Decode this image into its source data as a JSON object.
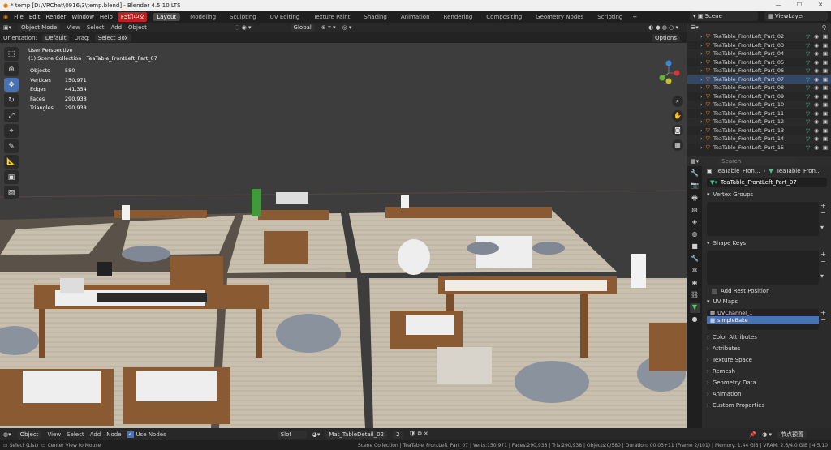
{
  "window": {
    "title": "* temp [D:\\VRChat\\0916\\3\\temp.blend] - Blender 4.5.10 LTS",
    "controls": [
      "—",
      "☐",
      "✕"
    ]
  },
  "menu": {
    "items": [
      "File",
      "Edit",
      "Render",
      "Window",
      "Help"
    ],
    "ime": "F5切中文"
  },
  "workspaces": [
    "Layout",
    "Modeling",
    "Sculpting",
    "UV Editing",
    "Texture Paint",
    "Shading",
    "Animation",
    "Rendering",
    "Compositing",
    "Geometry Nodes",
    "Scripting"
  ],
  "scene": {
    "label": "Scene",
    "view_layer": "ViewLayer"
  },
  "viewport_header": {
    "mode": "Object Mode",
    "menus": [
      "View",
      "Select",
      "Add",
      "Object"
    ],
    "transform": "Global"
  },
  "tool_settings": {
    "orientation_label": "Orientation:",
    "orientation": "Default",
    "drag_label": "Drag:",
    "drag": "Select Box",
    "options": "Options"
  },
  "overlay": {
    "view": "User Perspective",
    "collection": "(1) Scene Collection | TeaTable_FrontLeft_Part_07"
  },
  "stats": [
    {
      "k": "Objects",
      "v": "580"
    },
    {
      "k": "Vertices",
      "v": "150,971"
    },
    {
      "k": "Edges",
      "v": "441,354"
    },
    {
      "k": "Faces",
      "v": "290,938"
    },
    {
      "k": "Triangles",
      "v": "290,938"
    }
  ],
  "outliner": {
    "rows": [
      "TeaTable_FrontLeft_Part_02",
      "TeaTable_FrontLeft_Part_03",
      "TeaTable_FrontLeft_Part_04",
      "TeaTable_FrontLeft_Part_05",
      "TeaTable_FrontLeft_Part_06",
      "TeaTable_FrontLeft_Part_07",
      "TeaTable_FrontLeft_Part_08",
      "TeaTable_FrontLeft_Part_09",
      "TeaTable_FrontLeft_Part_10",
      "TeaTable_FrontLeft_Part_11",
      "TeaTable_FrontLeft_Part_12",
      "TeaTable_FrontLeft_Part_13",
      "TeaTable_FrontLeft_Part_14",
      "TeaTable_FrontLeft_Part_15"
    ],
    "selected_index": 5
  },
  "properties": {
    "search_placeholder": "Search",
    "breadcrumb": [
      "TeaTable_Fron...",
      "TeaTable_Fron..."
    ],
    "mesh_name": "TeaTable_FrontLeft_Part_07",
    "sections": {
      "vertex_groups": "Vertex Groups",
      "shape_keys": "Shape Keys",
      "add_rest_position": "Add Rest Position",
      "uv_maps": "UV Maps",
      "color_attributes": "Color Attributes",
      "attributes": "Attributes",
      "texture_space": "Texture Space",
      "remesh": "Remesh",
      "geometry_data": "Geometry Data",
      "animation": "Animation",
      "custom_properties": "Custom Properties"
    },
    "uv_maps": [
      "UVChannel_1",
      "simpleBake"
    ],
    "uv_selected": 1
  },
  "node_header": {
    "editor": "Object",
    "menus": [
      "View",
      "Select",
      "Add",
      "Node"
    ],
    "use_nodes": "Use Nodes",
    "slot": "Slot",
    "material": "Mat_TableDetail_02",
    "users": "2",
    "preset": "节点预置"
  },
  "status": {
    "left": [
      "Select (List)",
      "Center View to Mouse"
    ],
    "right": "Scene Collection | TeaTable_FrontLeft_Part_07 | Verts:150,971 | Faces:290,938 | Tris:290,938 | Objects:0/580 | Duration: 00:03+11 (Frame 2/101) | Memory: 1.44 GiB | VRAM: 2.6/4.0 GiB | 4.5.10"
  },
  "colors": {
    "accent": "#4772b3",
    "brand": "#e87d0d",
    "ime": "#c01f1f"
  }
}
